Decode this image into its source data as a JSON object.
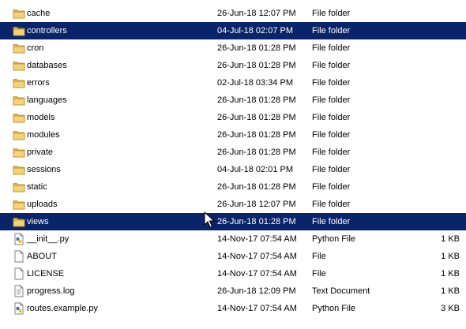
{
  "files": [
    {
      "name": "cache",
      "date": "26-Jun-18 12:07 PM",
      "type": "File folder",
      "size": "",
      "icon": "folder-icon",
      "selected": false
    },
    {
      "name": "controllers",
      "date": "04-Jul-18 02:07 PM",
      "type": "File folder",
      "size": "",
      "icon": "folder-icon",
      "selected": true
    },
    {
      "name": "cron",
      "date": "26-Jun-18 01:28 PM",
      "type": "File folder",
      "size": "",
      "icon": "folder-icon",
      "selected": false
    },
    {
      "name": "databases",
      "date": "26-Jun-18 01:28 PM",
      "type": "File folder",
      "size": "",
      "icon": "folder-icon",
      "selected": false
    },
    {
      "name": "errors",
      "date": "02-Jul-18 03:34 PM",
      "type": "File folder",
      "size": "",
      "icon": "folder-icon",
      "selected": false
    },
    {
      "name": "languages",
      "date": "26-Jun-18 01:28 PM",
      "type": "File folder",
      "size": "",
      "icon": "folder-icon",
      "selected": false
    },
    {
      "name": "models",
      "date": "26-Jun-18 01:28 PM",
      "type": "File folder",
      "size": "",
      "icon": "folder-icon",
      "selected": false
    },
    {
      "name": "modules",
      "date": "26-Jun-18 01:28 PM",
      "type": "File folder",
      "size": "",
      "icon": "folder-icon",
      "selected": false
    },
    {
      "name": "private",
      "date": "26-Jun-18 01:28 PM",
      "type": "File folder",
      "size": "",
      "icon": "folder-icon",
      "selected": false
    },
    {
      "name": "sessions",
      "date": "04-Jul-18 02:01 PM",
      "type": "File folder",
      "size": "",
      "icon": "folder-icon",
      "selected": false
    },
    {
      "name": "static",
      "date": "26-Jun-18 01:28 PM",
      "type": "File folder",
      "size": "",
      "icon": "folder-icon",
      "selected": false
    },
    {
      "name": "uploads",
      "date": "26-Jun-18 12:07 PM",
      "type": "File folder",
      "size": "",
      "icon": "folder-icon",
      "selected": false
    },
    {
      "name": "views",
      "date": "26-Jun-18 01:28 PM",
      "type": "File folder",
      "size": "",
      "icon": "folder-icon",
      "selected": true
    },
    {
      "name": "__init__.py",
      "date": "14-Nov-17 07:54 AM",
      "type": "Python File",
      "size": "1 KB",
      "icon": "python-file-icon",
      "selected": false
    },
    {
      "name": "ABOUT",
      "date": "14-Nov-17 07:54 AM",
      "type": "File",
      "size": "1 KB",
      "icon": "file-icon",
      "selected": false
    },
    {
      "name": "LICENSE",
      "date": "14-Nov-17 07:54 AM",
      "type": "File",
      "size": "1 KB",
      "icon": "file-icon",
      "selected": false
    },
    {
      "name": "progress.log",
      "date": "26-Jun-18 12:09 PM",
      "type": "Text Document",
      "size": "1 KB",
      "icon": "text-file-icon",
      "selected": false
    },
    {
      "name": "routes.example.py",
      "date": "14-Nov-17 07:54 AM",
      "type": "Python File",
      "size": "3 KB",
      "icon": "python-file-icon",
      "selected": false
    }
  ],
  "colors": {
    "selection": "#0a246a",
    "selection_text": "#ffffff",
    "folder": "#e8c25a"
  }
}
